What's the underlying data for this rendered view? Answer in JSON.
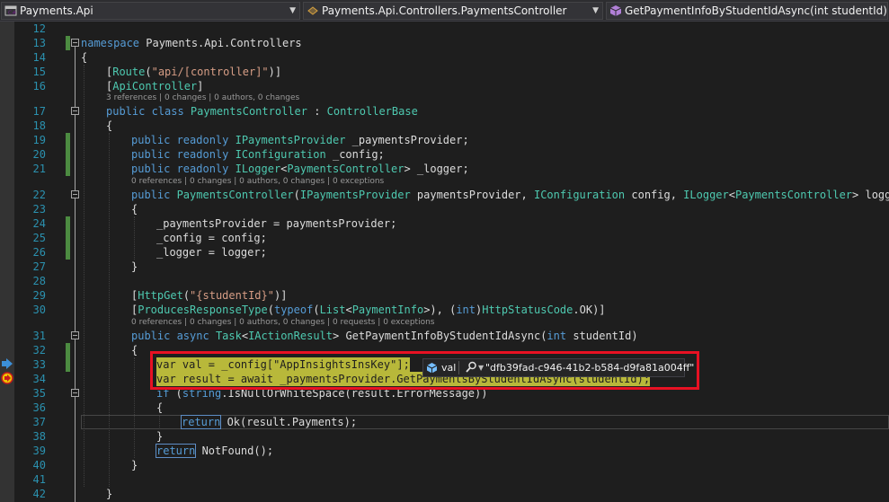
{
  "navbar": {
    "project": "Payments.Api",
    "type": "Payments.Api.Controllers.PaymentsController",
    "member": "GetPaymentInfoByStudentIdAsync(int studentId)"
  },
  "line_numbers": [
    "12",
    "13",
    "14",
    "15",
    "16",
    "17",
    "18",
    "19",
    "20",
    "21",
    "22",
    "23",
    "24",
    "25",
    "26",
    "27",
    "28",
    "29",
    "30",
    "31",
    "32",
    "33",
    "34",
    "35",
    "36",
    "37",
    "38",
    "39",
    "40",
    "41",
    "42"
  ],
  "codelens": {
    "class": "3 references | 0 changes | 0 authors, 0 changes",
    "ctor": "0 references | 0 changes | 0 authors, 0 changes | 0 exceptions",
    "method": "0 references | 0 changes | 0 authors, 0 changes | 0 requests | 0 exceptions"
  },
  "code": {
    "l13_kw": "namespace",
    "l13_name": " Payments.Api.Controllers",
    "l14": "{",
    "l15_open": "[",
    "l15_attr": "Route",
    "l15_p1": "(",
    "l15_str": "\"api/[controller]\"",
    "l15_close": ")]",
    "l16_open": "[",
    "l16_attr": "ApiController",
    "l16_close": "]",
    "l17_kw": "public class",
    "l17_name": " PaymentsController ",
    "l17_colon": ": ",
    "l17_base": "ControllerBase",
    "l18": "{",
    "l19_kw": "public readonly",
    "l19_type": " IPaymentsProvider",
    "l19_rest": " _paymentsProvider;",
    "l20_kw": "public readonly",
    "l20_type": " IConfiguration",
    "l20_rest": " _config;",
    "l21_kw": "public readonly",
    "l21_type": " ILogger",
    "l21_lt": "<",
    "l21_gen": "PaymentsController",
    "l21_rest": "> _logger;",
    "l22_kw": "public",
    "l22_name": " PaymentsController",
    "l22_p1": "(",
    "l22_t1": "IPaymentsProvider",
    "l22_a1": " paymentsProvider, ",
    "l22_t2": "IConfiguration",
    "l22_a2": " config, ",
    "l22_t3": "ILogger",
    "l22_lt": "<",
    "l22_gen": "PaymentsController",
    "l22_a3": "> logger)",
    "l23": "{",
    "l24": "_paymentsProvider = paymentsProvider;",
    "l25": "_config = config;",
    "l26": "_logger = logger;",
    "l27": "}",
    "l29_open": "[",
    "l29_attr": "HttpGet",
    "l29_p1": "(",
    "l29_str": "\"{studentId}\"",
    "l29_close": ")]",
    "l30_open": "[",
    "l30_attr": "ProducesResponseType",
    "l30_p1": "(",
    "l30_kw1": "typeof",
    "l30_p2": "(",
    "l30_t1": "List",
    "l30_lt": "<",
    "l30_t2": "PaymentInfo",
    "l30_p3": ">), (",
    "l30_kw2": "int",
    "l30_p4": ")",
    "l30_t3": "HttpStatusCode",
    "l30_rest": ".OK)]",
    "l31_kw": "public async",
    "l31_sp": " ",
    "l31_t1": "Task",
    "l31_lt": "<",
    "l31_t2": "IActionResult",
    "l31_mid": "> GetPaymentInfoByStudentIdAsync(",
    "l31_kw2": "int",
    "l31_rest": " studentId)",
    "l32": "{",
    "l33_kw": "var",
    "l33_mid": " val = _config[",
    "l33_str": "\"AppInsightsInsKey\"",
    "l33_rest": "];",
    "l34": "var result = await _paymentsProvider.GetPaymentsByStudentIdAsync(studentId);",
    "l35_kw": "if",
    "l35_p": " (",
    "l35_kw2": "string",
    "l35_rest": ".IsNullOrWhiteSpace(result.ErrorMessage))",
    "l36": "{",
    "l37_kw": "return",
    "l37_rest": " Ok(result.Payments);",
    "l38": "}",
    "l39_kw": "return",
    "l39_rest": " NotFound();",
    "l40": "}",
    "l42": "}"
  },
  "datatip": {
    "name": "val",
    "value": "\"dfb39fad-c946-41b2-b584-d9fa81a004ff\""
  }
}
